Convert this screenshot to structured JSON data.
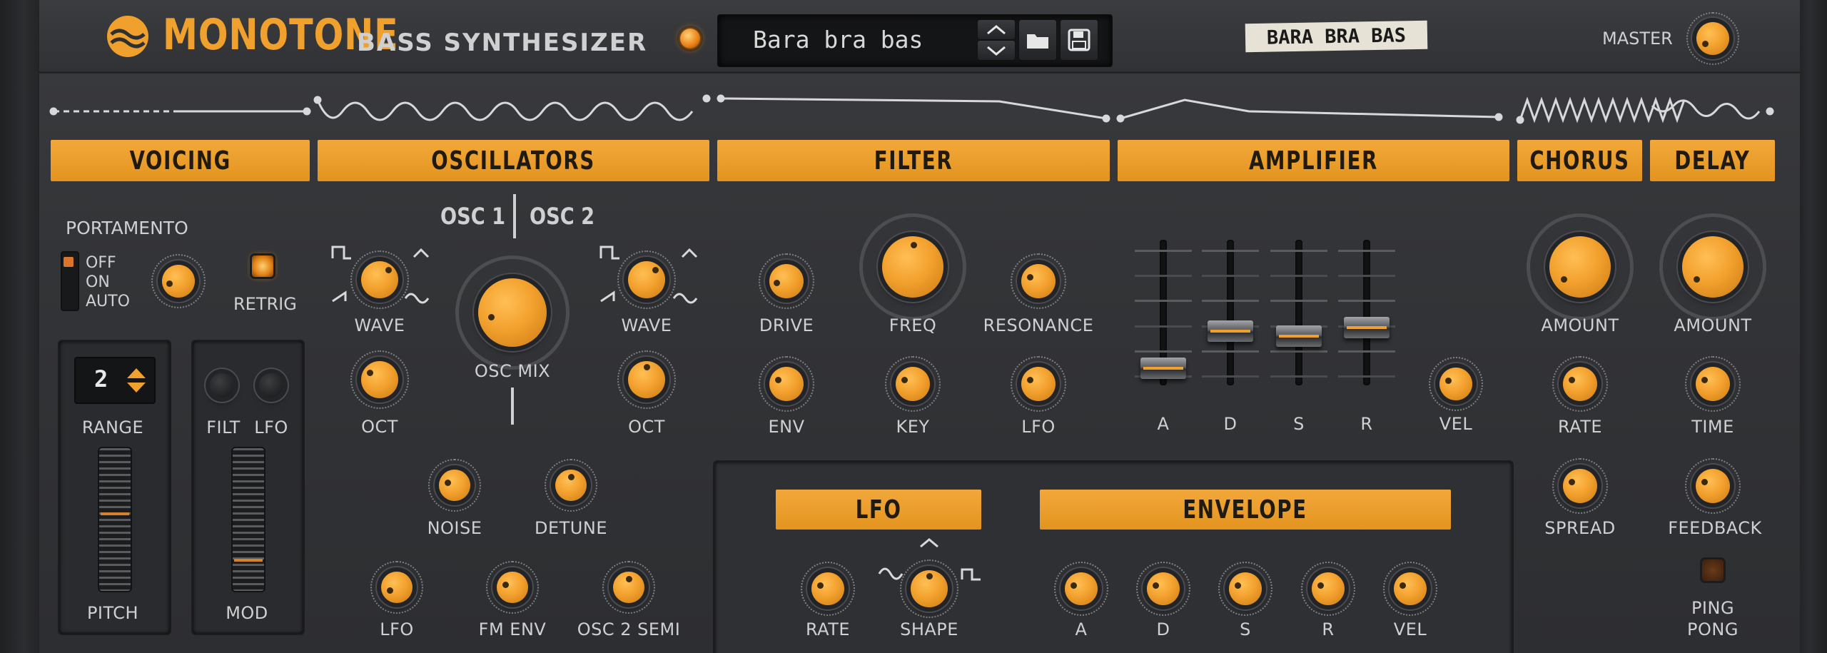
{
  "brand": {
    "name": "MONOTONE",
    "subtitle": "BASS SYNTHESIZER"
  },
  "preset": {
    "name": "Bara bra bas",
    "tape_label": "BARA BRA BAS"
  },
  "master": {
    "label": "MASTER"
  },
  "sections": {
    "voicing": "VOICING",
    "oscillators": "OSCILLATORS",
    "filter": "FILTER",
    "amplifier": "AMPLIFIER",
    "chorus": "CHORUS",
    "delay": "DELAY",
    "lfo": "LFO",
    "envelope": "ENVELOPE"
  },
  "voicing": {
    "portamento": "PORTAMENTO",
    "mode_options": [
      "OFF",
      "ON",
      "AUTO"
    ],
    "retrig": "RETRIG",
    "range_value": "2",
    "range": "RANGE",
    "filt": "FILT",
    "lfo": "LFO",
    "pitch": "PITCH",
    "mod": "MOD"
  },
  "osc": {
    "osc1": "OSC 1",
    "osc2": "OSC 2",
    "wave": "WAVE",
    "oct": "OCT",
    "osc_mix": "OSC MIX",
    "noise": "NOISE",
    "detune": "DETUNE",
    "lfo": "LFO",
    "fm_env": "FM ENV",
    "osc2_semi": "OSC 2 SEMI"
  },
  "filter": {
    "drive": "DRIVE",
    "freq": "FREQ",
    "resonance": "RESONANCE",
    "env": "ENV",
    "key": "KEY",
    "lfo": "LFO"
  },
  "amp": {
    "a": "A",
    "d": "D",
    "s": "S",
    "r": "R",
    "vel": "VEL",
    "levels": {
      "a": 0.05,
      "d": 0.35,
      "s": 0.31,
      "r": 0.38
    }
  },
  "chorus": {
    "amount": "AMOUNT",
    "rate": "RATE",
    "spread": "SPREAD"
  },
  "delay": {
    "amount": "AMOUNT",
    "time": "TIME",
    "feedback": "FEEDBACK",
    "ping": "PING",
    "pong": "PONG"
  },
  "lfo": {
    "rate": "RATE",
    "shape": "SHAPE"
  },
  "envelope": {
    "a": "A",
    "d": "D",
    "s": "S",
    "r": "R",
    "vel": "VEL"
  },
  "colors": {
    "accent": "#efa02d",
    "panel": "#333437",
    "text": "#cfd0d2"
  },
  "icons": [
    "menu-arrow-icon",
    "power-led-icon",
    "arrow-up-icon",
    "arrow-down-icon",
    "folder-icon",
    "save-icon"
  ]
}
